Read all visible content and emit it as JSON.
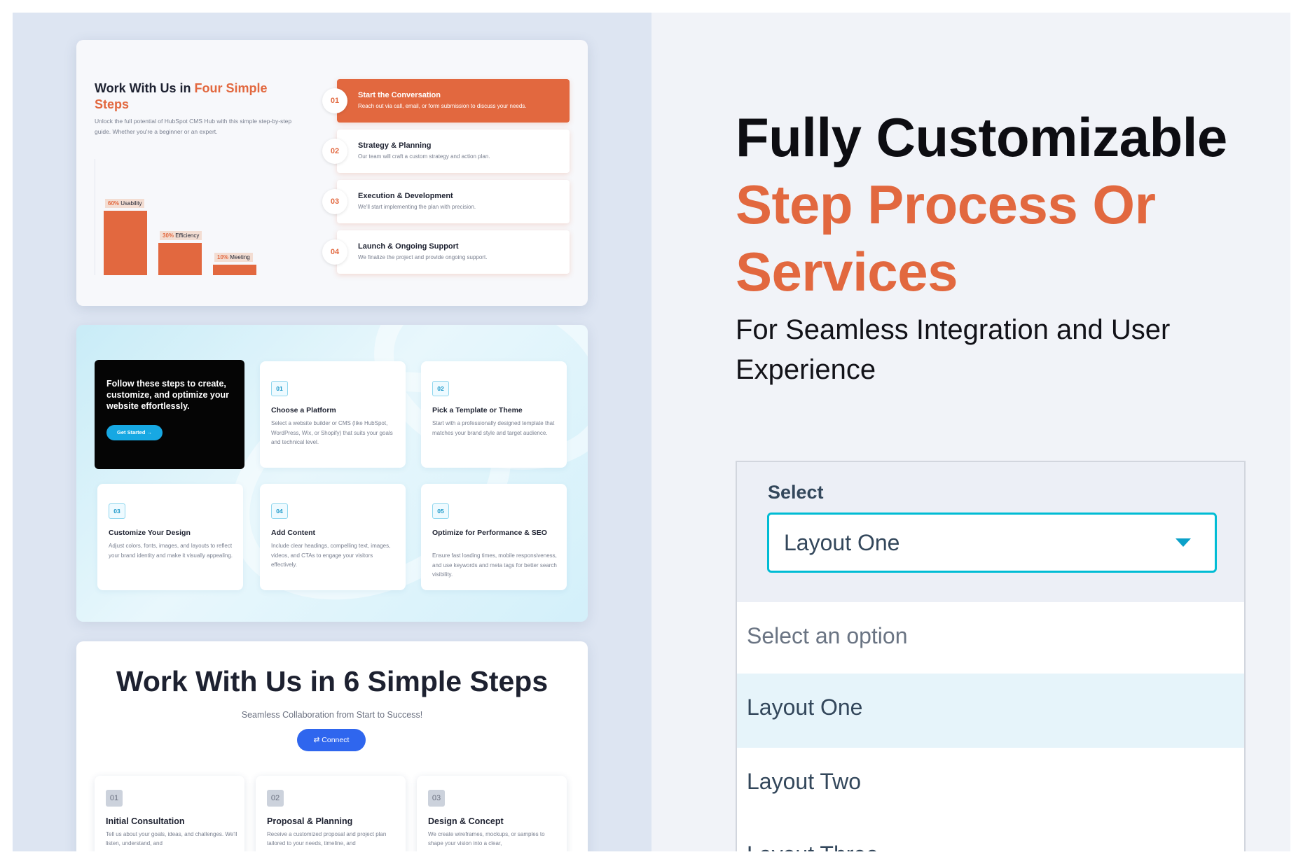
{
  "colors": {
    "accent_orange": "#e2683f",
    "accent_cyan": "#00bcd4",
    "accent_blue": "#2f66ee",
    "text_dark": "#1d2130"
  },
  "card1": {
    "title_prefix": "Work With Us in ",
    "title_accent": "Four Simple Steps",
    "description": "Unlock the full potential of HubSpot CMS Hub with this simple step-by-step guide. Whether you're a beginner or an expert.",
    "bars": [
      {
        "pct": "60%",
        "label": "Usability",
        "value": 60
      },
      {
        "pct": "30%",
        "label": "Efficiency",
        "value": 30
      },
      {
        "pct": "10%",
        "label": "Meeting",
        "value": 10
      }
    ],
    "steps": [
      {
        "num": "01",
        "title": "Start the Conversation",
        "desc": "Reach out via call, email, or form submission to discuss your needs.",
        "active": true
      },
      {
        "num": "02",
        "title": "Strategy & Planning",
        "desc": "Our team will craft a custom strategy and action plan.",
        "active": false
      },
      {
        "num": "03",
        "title": "Execution & Development",
        "desc": "We'll start implementing the plan with precision.",
        "active": false
      },
      {
        "num": "04",
        "title": "Launch & Ongoing Support",
        "desc": "We finalize the project and provide ongoing support.",
        "active": false
      }
    ]
  },
  "card2": {
    "intro": "Follow these steps to create, customize, and optimize your website effortlessly.",
    "cta": "Get Started →",
    "items": [
      {
        "num": "01",
        "title": "Choose a Platform",
        "desc": "Select a website builder or CMS (like HubSpot, WordPress, Wix, or Shopify) that suits your goals and technical level."
      },
      {
        "num": "02",
        "title": "Pick a Template or Theme",
        "desc": "Start with a professionally designed template that matches your brand style and target audience."
      },
      {
        "num": "03",
        "title": "Customize Your Design",
        "desc": "Adjust colors, fonts, images, and layouts to reflect your brand identity and make it visually appealing."
      },
      {
        "num": "04",
        "title": "Add Content",
        "desc": "Include clear headings, compelling text, images, videos, and CTAs to engage your visitors effectively."
      },
      {
        "num": "05",
        "title": "Optimize for Performance & SEO",
        "desc": "Ensure fast loading times, mobile responsiveness, and use keywords and meta tags for better search visibility."
      }
    ]
  },
  "card3": {
    "title": "Work With Us in 6 Simple Steps",
    "subtitle": "Seamless Collaboration from Start to Success!",
    "connect": "⇄ Connect",
    "steps": [
      {
        "num": "01",
        "title": "Initial Consultation",
        "desc": "Tell us about your goals, ideas, and challenges. We'll listen, understand, and"
      },
      {
        "num": "02",
        "title": "Proposal & Planning",
        "desc": "Receive a customized proposal and project plan tailored to your needs, timeline, and"
      },
      {
        "num": "03",
        "title": "Design & Concept",
        "desc": "We create wireframes, mockups, or samples to shape your vision into a clear,"
      }
    ]
  },
  "headline": {
    "line1": "Fully Customizable",
    "line2": "Step Process Or",
    "line3": "Services",
    "subline": "For Seamless Integration and User Experience"
  },
  "select": {
    "label": "Select",
    "value": "Layout One",
    "options": [
      {
        "label": "Select an option",
        "placeholder": true,
        "highlighted": false
      },
      {
        "label": "Layout One",
        "placeholder": false,
        "highlighted": true
      },
      {
        "label": "Layout Two",
        "placeholder": false,
        "highlighted": false
      },
      {
        "label": "Layout Three",
        "placeholder": false,
        "highlighted": false
      }
    ]
  }
}
